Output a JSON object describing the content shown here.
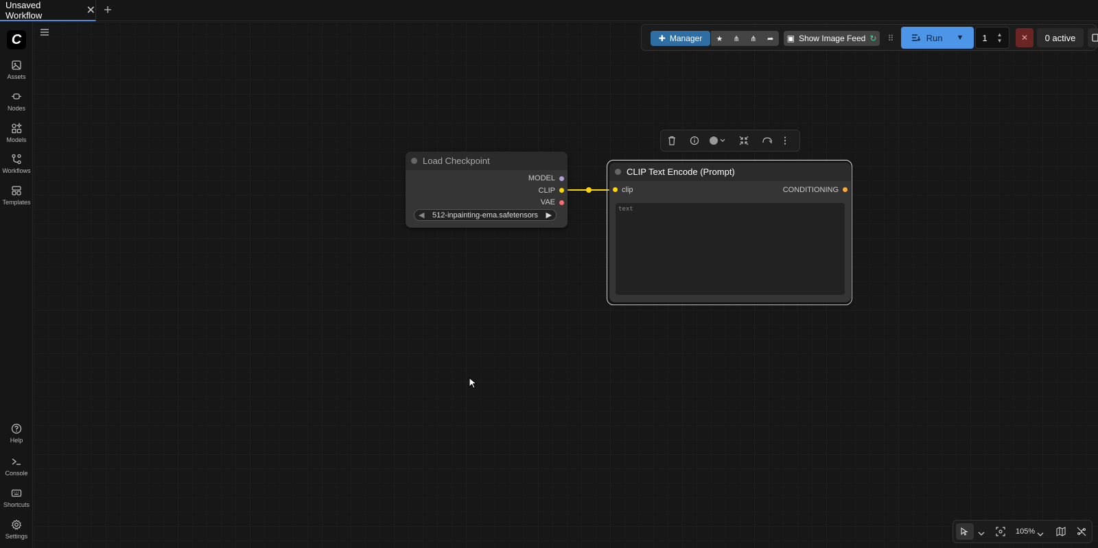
{
  "tabs": [
    {
      "label": "Unsaved Workflow"
    }
  ],
  "sidebar": {
    "items": [
      {
        "label": "Assets"
      },
      {
        "label": "Nodes"
      },
      {
        "label": "Models"
      },
      {
        "label": "Workflows"
      },
      {
        "label": "Templates"
      }
    ],
    "bottom_items": [
      {
        "label": "Help"
      },
      {
        "label": "Console"
      },
      {
        "label": "Shortcuts"
      },
      {
        "label": "Settings"
      }
    ]
  },
  "toolbar": {
    "manager_label": "Manager",
    "image_feed_label": "Show Image Feed",
    "run_label": "Run",
    "batch_count": "1",
    "active_label": "0 active"
  },
  "nodes": {
    "load_checkpoint": {
      "title": "Load Checkpoint",
      "outputs": [
        "MODEL",
        "CLIP",
        "VAE"
      ],
      "ckpt_name": "512-inpainting-ema.safetensors"
    },
    "clip_text_encode": {
      "title": "CLIP Text Encode (Prompt)",
      "input": "clip",
      "output": "CONDITIONING",
      "text_placeholder": "text"
    }
  },
  "zoom": "105%",
  "colors": {
    "accent": "#4d95e6",
    "manager": "#2f6ea3",
    "clip_link": "#ffd500",
    "model_slot": "#b39ddb",
    "vae_slot": "#ff6e6e",
    "conditioning_slot": "#ffa931"
  }
}
